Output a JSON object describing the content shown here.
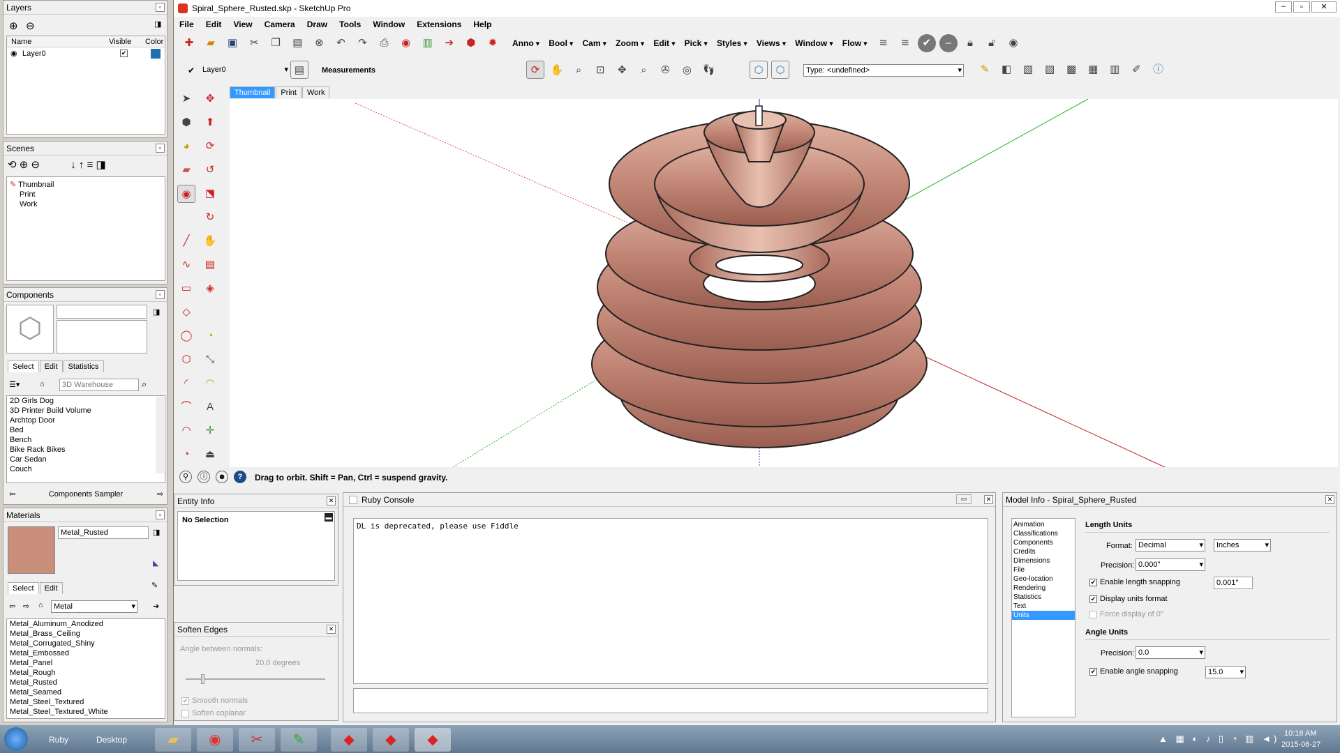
{
  "app": {
    "title": "Spiral_Sphere_Rusted.skp - SketchUp Pro"
  },
  "menubar": [
    "File",
    "Edit",
    "View",
    "Camera",
    "Draw",
    "Tools",
    "Window",
    "Extensions",
    "Help"
  ],
  "toolbar_dropdowns": [
    "Anno",
    "Bool",
    "Cam",
    "Zoom",
    "Edit",
    "Pick",
    "Styles",
    "Views",
    "Window",
    "Flow"
  ],
  "layer_selector": {
    "value": "Layer0"
  },
  "measurements_label": "Measurements",
  "type_field": {
    "value": "Type: <undefined>"
  },
  "scene_tabs": [
    "Thumbnail",
    "Print",
    "Work"
  ],
  "status_bar": {
    "text": "Drag to orbit. Shift = Pan, Ctrl = suspend gravity."
  },
  "layers": {
    "title": "Layers",
    "columns": [
      "Name",
      "Visible",
      "Color"
    ],
    "rows": [
      {
        "name": "Layer0",
        "visible": "✔",
        "color": "#1f6fae"
      }
    ]
  },
  "scenes": {
    "title": "Scenes",
    "items": [
      "Thumbnail",
      "Print",
      "Work"
    ]
  },
  "components": {
    "title": "Components",
    "tabs": [
      "Select",
      "Edit",
      "Statistics"
    ],
    "search_placeholder": "3D Warehouse",
    "items": [
      "2D Girls Dog",
      "3D Printer Build Volume",
      "Archtop Door",
      "Bed",
      "Bench",
      "Bike Rack Bikes",
      "Car Sedan",
      "Couch"
    ],
    "footer": "Components Sampler"
  },
  "materials": {
    "title": "Materials",
    "current": "Metal_Rusted",
    "tabs": [
      "Select",
      "Edit"
    ],
    "category": "Metal",
    "items": [
      "Metal_Aluminum_Anodized",
      "Metal_Brass_Ceiling",
      "Metal_Corrugated_Shiny",
      "Metal_Embossed",
      "Metal_Panel",
      "Metal_Rough",
      "Metal_Rusted",
      "Metal_Seamed",
      "Metal_Steel_Textured",
      "Metal_Steel_Textured_White"
    ]
  },
  "entity_info": {
    "title": "Entity Info",
    "selection": "No Selection"
  },
  "soften_edges": {
    "title": "Soften Edges",
    "angle_label": "Angle between normals:",
    "angle_value": "20.0  degrees",
    "smooth_normals": "Smooth normals",
    "soften_coplanar": "Soften coplanar"
  },
  "ruby_console": {
    "title": "Ruby Console",
    "output": "DL is deprecated, please use Fiddle"
  },
  "model_info": {
    "title": "Model Info - Spiral_Sphere_Rusted",
    "categories": [
      "Animation",
      "Classifications",
      "Components",
      "Credits",
      "Dimensions",
      "File",
      "Geo-location",
      "Rendering",
      "Statistics",
      "Text",
      "Units"
    ],
    "selected": "Units",
    "length_units": {
      "heading": "Length Units",
      "format_label": "Format:",
      "format": "Decimal",
      "unit": "Inches",
      "precision_label": "Precision:",
      "precision": "0.000\"",
      "snap_label": "Enable length snapping",
      "snap_value": "0.001\"",
      "display_units": "Display units format",
      "force": "Force display of 0\""
    },
    "angle_units": {
      "heading": "Angle Units",
      "precision_label": "Precision:",
      "precision": "0.0",
      "snap_label": "Enable angle snapping",
      "snap_value": "15.0"
    }
  },
  "taskbar": {
    "items": [
      "Ruby",
      "Desktop"
    ],
    "time": "10:18 AM",
    "date": "2015-06-27"
  },
  "colors": {
    "accent": "#3399ff",
    "rust": "#c98e7c"
  }
}
